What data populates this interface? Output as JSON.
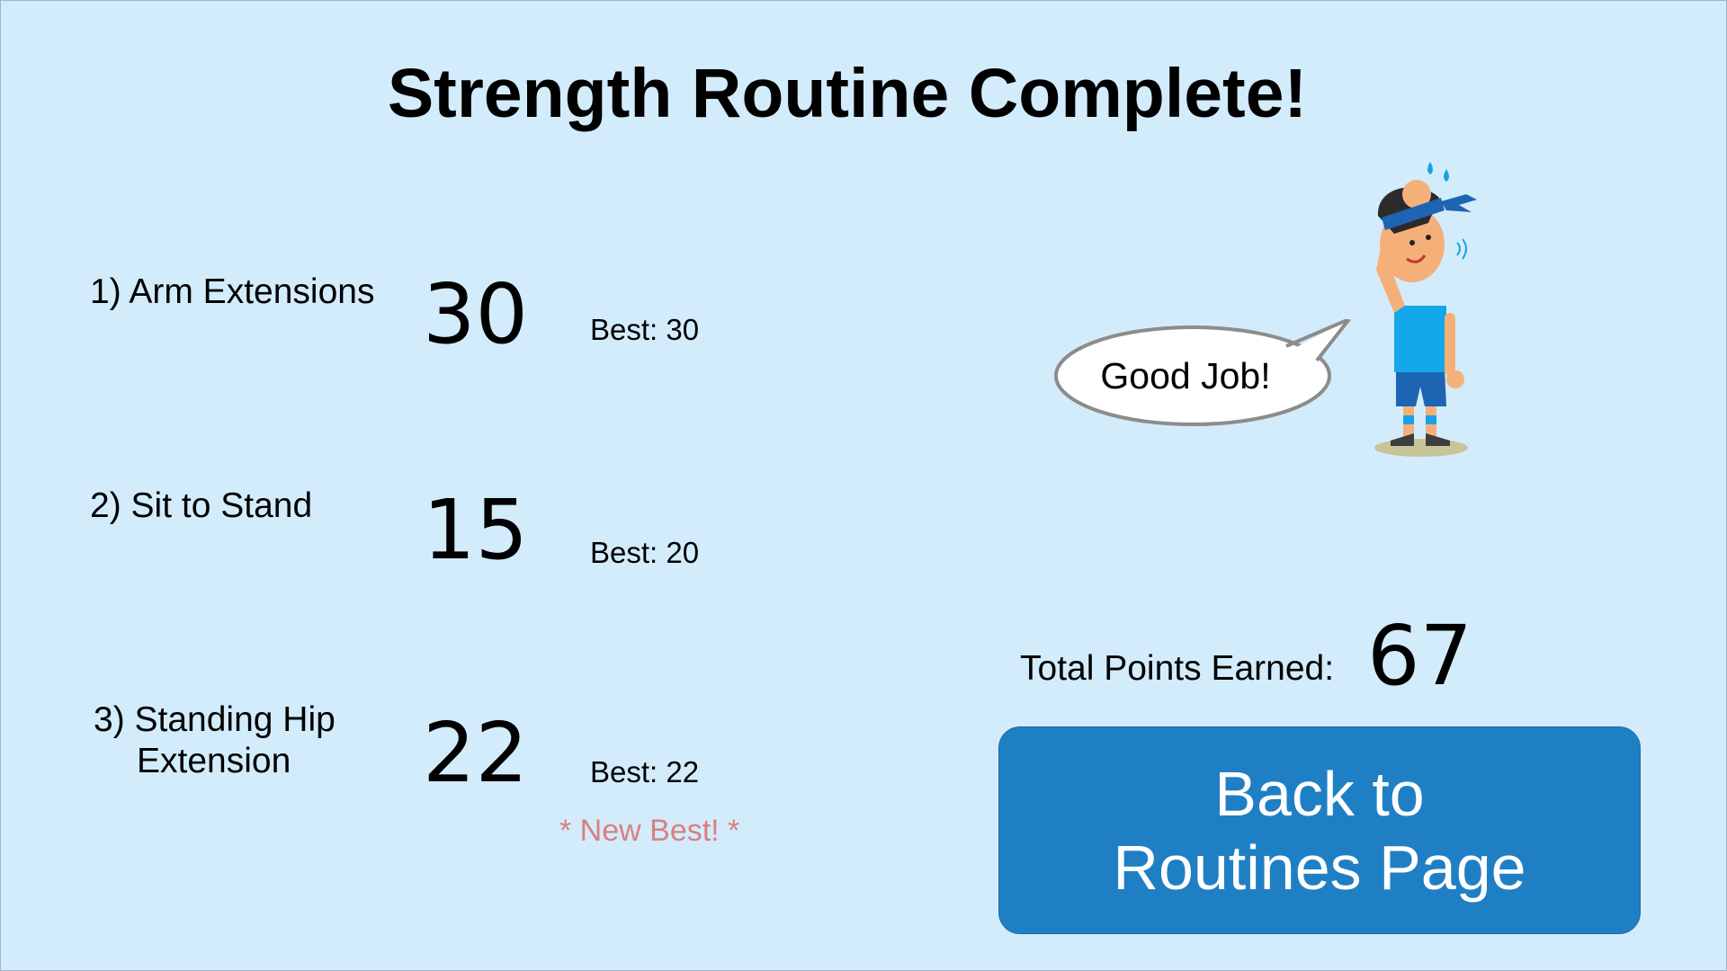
{
  "title": "Strength Routine Complete!",
  "exercises": [
    {
      "label": "1) Arm Extensions",
      "score": "30",
      "best": "Best: 30"
    },
    {
      "label": "2) Sit to Stand",
      "score": "15",
      "best": "Best: 20"
    },
    {
      "label_line1": "3) Standing Hip",
      "label_line2": "Extension",
      "score": "22",
      "best": "Best: 22",
      "note": "* New Best! *"
    }
  ],
  "speech_bubble": "Good Job!",
  "mascot_icon": "athlete-mascot-icon",
  "total": {
    "label": "Total Points Earned:",
    "value": "67"
  },
  "back_button": {
    "line1": "Back to",
    "line2": "Routines Page"
  },
  "colors": {
    "background": "#d3ecfc",
    "button": "#1f7fc5",
    "new_best": "#d98080"
  }
}
